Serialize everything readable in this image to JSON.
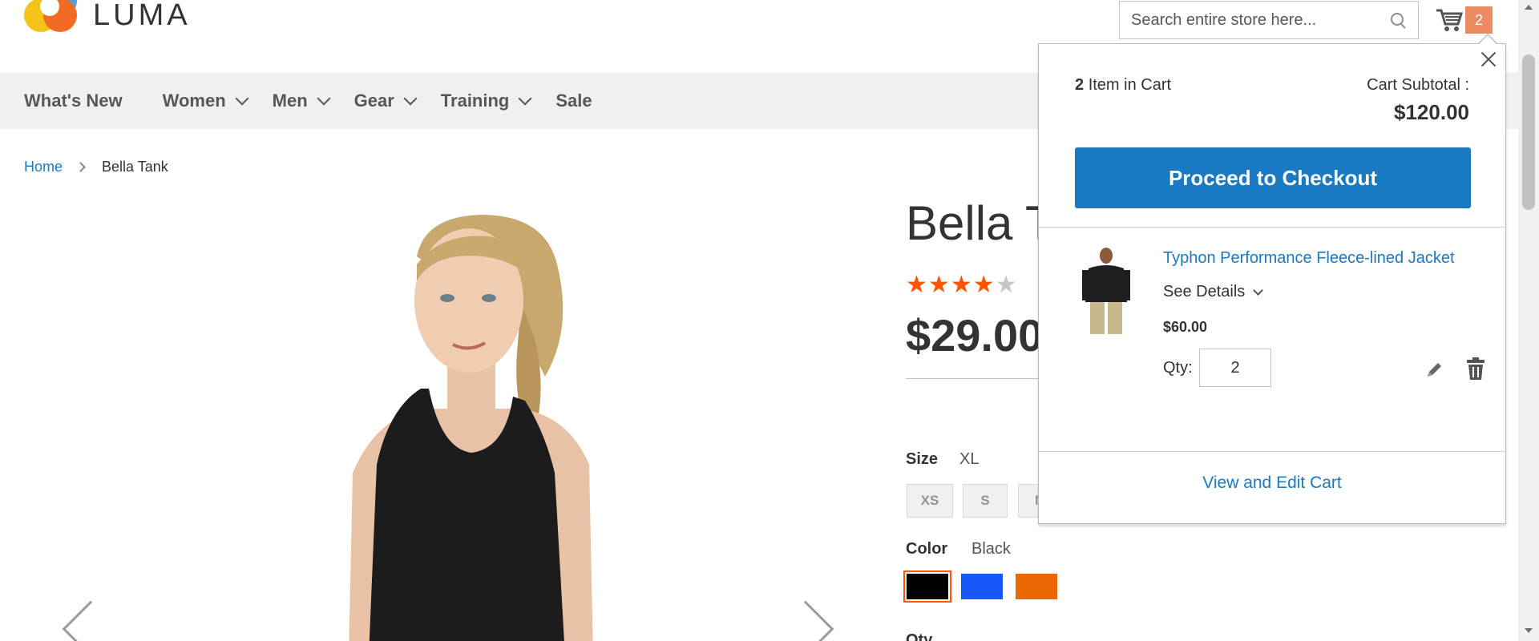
{
  "brand": {
    "name": "LUMA"
  },
  "header": {
    "search_placeholder": "Search entire store here...",
    "cart_count": "2"
  },
  "nav": {
    "items": [
      {
        "label": "What's New",
        "has_dropdown": false
      },
      {
        "label": "Women",
        "has_dropdown": true
      },
      {
        "label": "Men",
        "has_dropdown": true
      },
      {
        "label": "Gear",
        "has_dropdown": true
      },
      {
        "label": "Training",
        "has_dropdown": true
      },
      {
        "label": "Sale",
        "has_dropdown": false
      }
    ]
  },
  "breadcrumb": {
    "home": "Home",
    "current": "Bella Tank"
  },
  "product": {
    "title": "Bella Tank",
    "rating_stars": 4,
    "rating_max": 5,
    "price": "$29.00",
    "size_label": "Size",
    "size_selected": "XL",
    "sizes": [
      "XS",
      "S",
      "M"
    ],
    "color_label": "Color",
    "color_selected": "Black",
    "colors": [
      {
        "name": "Black",
        "hex": "#000000",
        "selected": true
      },
      {
        "name": "Blue",
        "hex": "#1857f7",
        "selected": false
      },
      {
        "name": "Orange",
        "hex": "#eb6703",
        "selected": false
      }
    ],
    "qty_label": "Qty"
  },
  "minicart": {
    "count": "2",
    "count_suffix": "Item in Cart",
    "subtotal_label": "Cart Subtotal :",
    "subtotal": "$120.00",
    "checkout_label": "Proceed to Checkout",
    "item": {
      "name": "Typhon Performance Fleece-lined Jacket",
      "see_details": "See Details",
      "price": "$60.00",
      "qty_label": "Qty:",
      "qty": "2"
    },
    "view_cart_label": "View and Edit Cart"
  },
  "colors": {
    "link": "#1979c3",
    "primary_button": "#1979c3",
    "star": "#ff5501",
    "cart_counter": "#ee8a61"
  }
}
